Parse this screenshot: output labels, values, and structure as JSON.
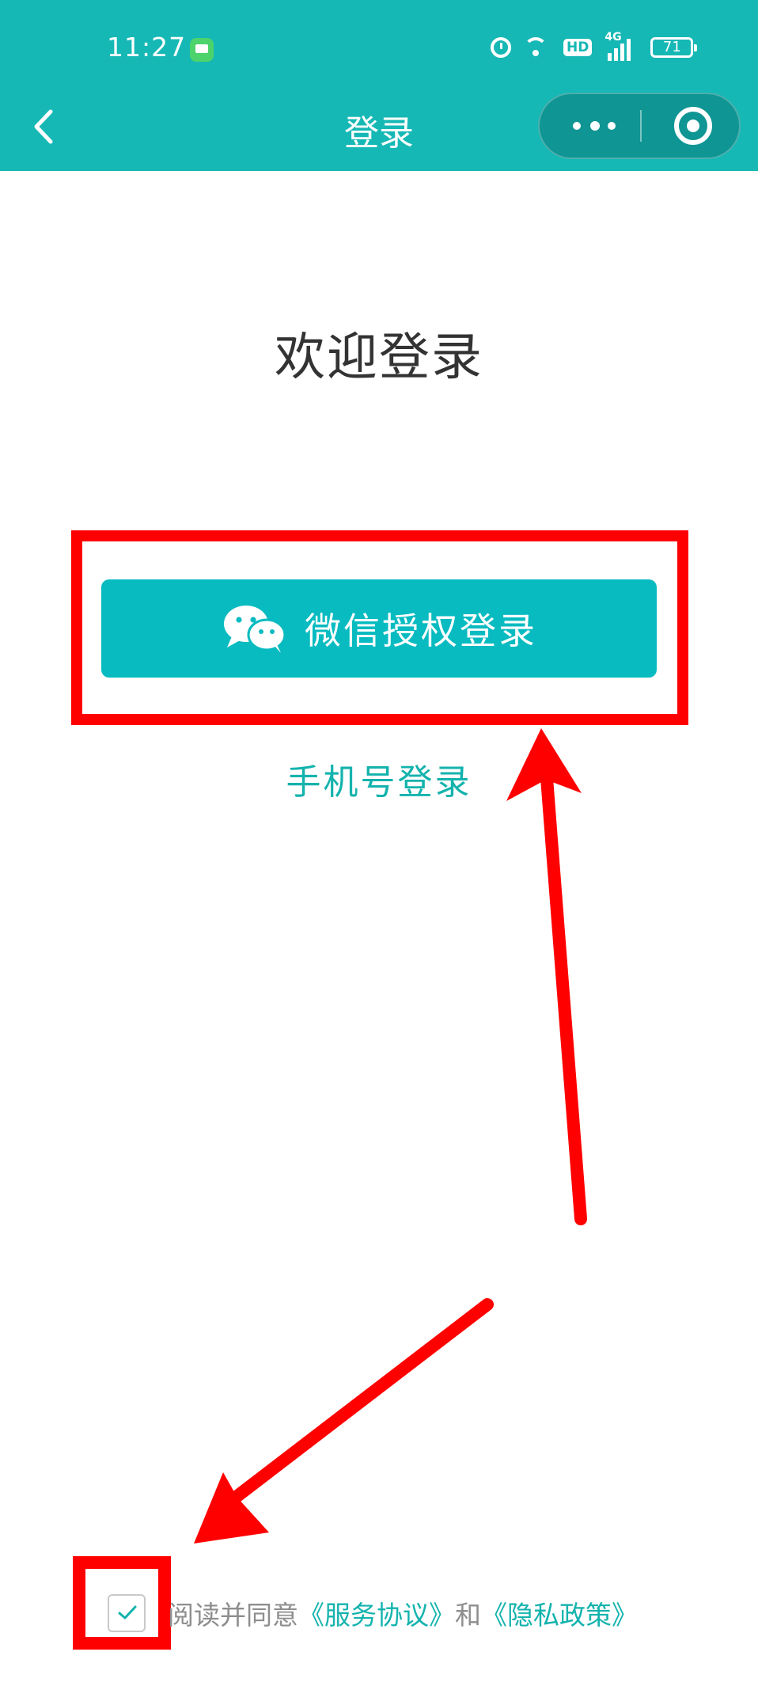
{
  "status_bar": {
    "time": "11:27",
    "hd_badge": "HD",
    "network_type": "4G",
    "battery_level": "71",
    "icons": [
      "message-app-icon",
      "alarm-icon",
      "wifi-icon",
      "signal-icon",
      "battery-icon"
    ]
  },
  "nav": {
    "title": "登录",
    "back_icon": "chevron-left-icon",
    "capsule_icons": [
      "more-icon",
      "target-icon"
    ]
  },
  "main": {
    "welcome_title": "欢迎登录",
    "wechat_button_label": "微信授权登录",
    "wechat_icon": "wechat-icon",
    "phone_login_label": "手机号登录"
  },
  "agreement": {
    "checked": true,
    "prefix": "阅读并同意",
    "service_link": "《服务协议》",
    "conjunction": "和",
    "privacy_link": "《隐私政策》"
  },
  "colors": {
    "header_teal": "#16b8b5",
    "button_teal": "#07bbc0",
    "link_teal": "#14b3ad",
    "annotation_red": "#ff0000"
  }
}
